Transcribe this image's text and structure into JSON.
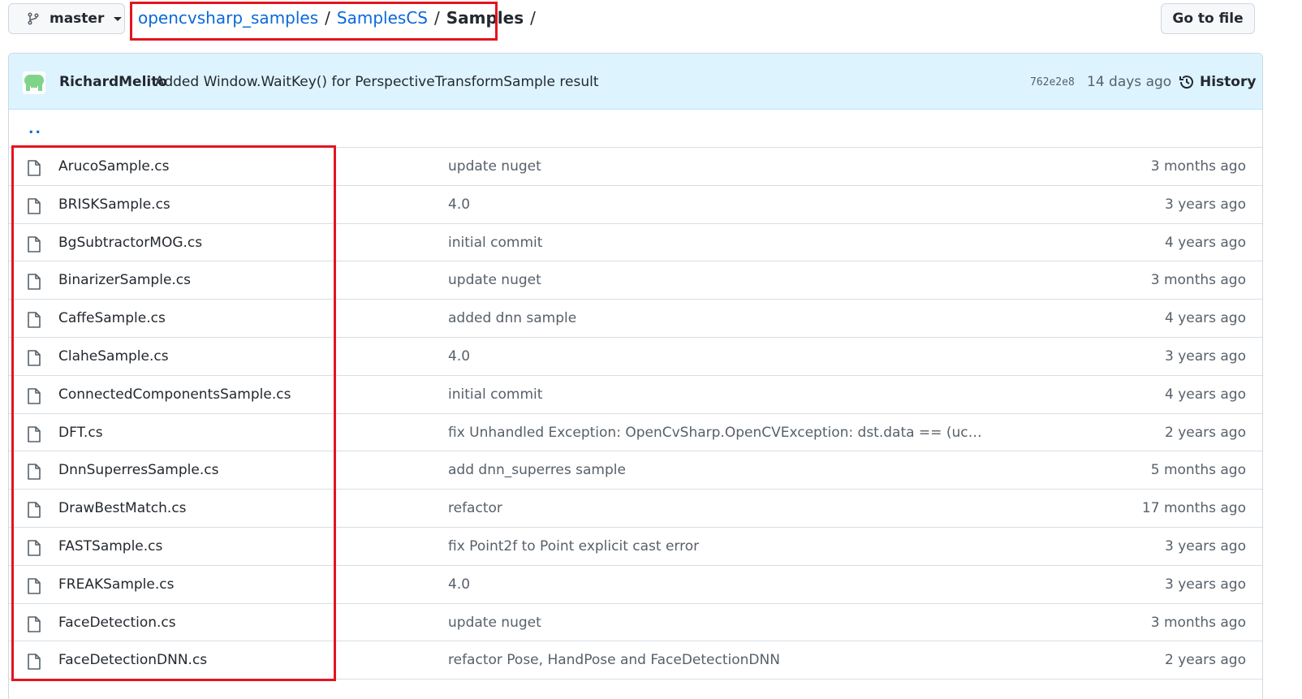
{
  "branch": {
    "label": "master"
  },
  "breadcrumb": {
    "repo": "opencvsharp_samples",
    "sep1": "/",
    "folder": "SamplesCS",
    "sep2": "/",
    "current": "Samples",
    "sep3": "/"
  },
  "goto_file": {
    "label": "Go to file"
  },
  "latest_commit": {
    "author": "RichardMelito",
    "message": "Added Window.WaitKey() for PerspectiveTransformSample result",
    "sha": "762e2e8",
    "time": "14 days ago",
    "history_label": "History"
  },
  "parent_dir": {
    "label": ".."
  },
  "files": [
    {
      "name": "ArucoSample.cs",
      "commit": "update nuget",
      "age": "3 months ago"
    },
    {
      "name": "BRISKSample.cs",
      "commit": "4.0",
      "age": "3 years ago"
    },
    {
      "name": "BgSubtractorMOG.cs",
      "commit": "initial commit",
      "age": "4 years ago"
    },
    {
      "name": "BinarizerSample.cs",
      "commit": "update nuget",
      "age": "3 months ago"
    },
    {
      "name": "CaffeSample.cs",
      "commit": "added dnn sample",
      "age": "4 years ago"
    },
    {
      "name": "ClaheSample.cs",
      "commit": "4.0",
      "age": "3 years ago"
    },
    {
      "name": "ConnectedComponentsSample.cs",
      "commit": "initial commit",
      "age": "4 years ago"
    },
    {
      "name": "DFT.cs",
      "commit": "fix Unhandled Exception: OpenCvSharp.OpenCVException: dst.data == (uc…",
      "age": "2 years ago"
    },
    {
      "name": "DnnSuperresSample.cs",
      "commit": "add dnn_superres sample",
      "age": "5 months ago"
    },
    {
      "name": "DrawBestMatch.cs",
      "commit": "refactor",
      "age": "17 months ago"
    },
    {
      "name": "FASTSample.cs",
      "commit": "fix Point2f to Point explicit cast error",
      "age": "3 years ago"
    },
    {
      "name": "FREAKSample.cs",
      "commit": "4.0",
      "age": "3 years ago"
    },
    {
      "name": "FaceDetection.cs",
      "commit": "update nuget",
      "age": "3 months ago"
    },
    {
      "name": "FaceDetectionDNN.cs",
      "commit": "refactor Pose, HandPose and FaceDetectionDNN",
      "age": "2 years ago"
    }
  ],
  "colors": {
    "link": "#0969da",
    "highlight": "#e3151f",
    "commit_bar": "#ddf4ff"
  },
  "icons": {
    "branch": "git-branch-icon",
    "file": "file-icon",
    "history": "history-icon",
    "avatar": "avatar"
  }
}
